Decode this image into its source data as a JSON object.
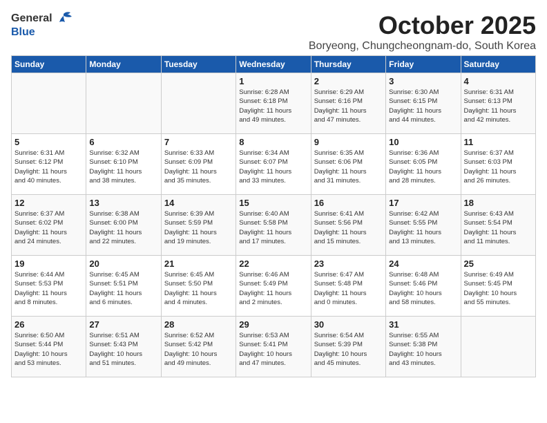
{
  "header": {
    "logo_general": "General",
    "logo_blue": "Blue",
    "main_title": "October 2025",
    "subtitle": "Boryeong, Chungcheongnam-do, South Korea"
  },
  "days_of_week": [
    "Sunday",
    "Monday",
    "Tuesday",
    "Wednesday",
    "Thursday",
    "Friday",
    "Saturday"
  ],
  "weeks": [
    [
      {
        "num": "",
        "info": ""
      },
      {
        "num": "",
        "info": ""
      },
      {
        "num": "",
        "info": ""
      },
      {
        "num": "1",
        "info": "Sunrise: 6:28 AM\nSunset: 6:18 PM\nDaylight: 11 hours\nand 49 minutes."
      },
      {
        "num": "2",
        "info": "Sunrise: 6:29 AM\nSunset: 6:16 PM\nDaylight: 11 hours\nand 47 minutes."
      },
      {
        "num": "3",
        "info": "Sunrise: 6:30 AM\nSunset: 6:15 PM\nDaylight: 11 hours\nand 44 minutes."
      },
      {
        "num": "4",
        "info": "Sunrise: 6:31 AM\nSunset: 6:13 PM\nDaylight: 11 hours\nand 42 minutes."
      }
    ],
    [
      {
        "num": "5",
        "info": "Sunrise: 6:31 AM\nSunset: 6:12 PM\nDaylight: 11 hours\nand 40 minutes."
      },
      {
        "num": "6",
        "info": "Sunrise: 6:32 AM\nSunset: 6:10 PM\nDaylight: 11 hours\nand 38 minutes."
      },
      {
        "num": "7",
        "info": "Sunrise: 6:33 AM\nSunset: 6:09 PM\nDaylight: 11 hours\nand 35 minutes."
      },
      {
        "num": "8",
        "info": "Sunrise: 6:34 AM\nSunset: 6:07 PM\nDaylight: 11 hours\nand 33 minutes."
      },
      {
        "num": "9",
        "info": "Sunrise: 6:35 AM\nSunset: 6:06 PM\nDaylight: 11 hours\nand 31 minutes."
      },
      {
        "num": "10",
        "info": "Sunrise: 6:36 AM\nSunset: 6:05 PM\nDaylight: 11 hours\nand 28 minutes."
      },
      {
        "num": "11",
        "info": "Sunrise: 6:37 AM\nSunset: 6:03 PM\nDaylight: 11 hours\nand 26 minutes."
      }
    ],
    [
      {
        "num": "12",
        "info": "Sunrise: 6:37 AM\nSunset: 6:02 PM\nDaylight: 11 hours\nand 24 minutes."
      },
      {
        "num": "13",
        "info": "Sunrise: 6:38 AM\nSunset: 6:00 PM\nDaylight: 11 hours\nand 22 minutes."
      },
      {
        "num": "14",
        "info": "Sunrise: 6:39 AM\nSunset: 5:59 PM\nDaylight: 11 hours\nand 19 minutes."
      },
      {
        "num": "15",
        "info": "Sunrise: 6:40 AM\nSunset: 5:58 PM\nDaylight: 11 hours\nand 17 minutes."
      },
      {
        "num": "16",
        "info": "Sunrise: 6:41 AM\nSunset: 5:56 PM\nDaylight: 11 hours\nand 15 minutes."
      },
      {
        "num": "17",
        "info": "Sunrise: 6:42 AM\nSunset: 5:55 PM\nDaylight: 11 hours\nand 13 minutes."
      },
      {
        "num": "18",
        "info": "Sunrise: 6:43 AM\nSunset: 5:54 PM\nDaylight: 11 hours\nand 11 minutes."
      }
    ],
    [
      {
        "num": "19",
        "info": "Sunrise: 6:44 AM\nSunset: 5:53 PM\nDaylight: 11 hours\nand 8 minutes."
      },
      {
        "num": "20",
        "info": "Sunrise: 6:45 AM\nSunset: 5:51 PM\nDaylight: 11 hours\nand 6 minutes."
      },
      {
        "num": "21",
        "info": "Sunrise: 6:45 AM\nSunset: 5:50 PM\nDaylight: 11 hours\nand 4 minutes."
      },
      {
        "num": "22",
        "info": "Sunrise: 6:46 AM\nSunset: 5:49 PM\nDaylight: 11 hours\nand 2 minutes."
      },
      {
        "num": "23",
        "info": "Sunrise: 6:47 AM\nSunset: 5:48 PM\nDaylight: 11 hours\nand 0 minutes."
      },
      {
        "num": "24",
        "info": "Sunrise: 6:48 AM\nSunset: 5:46 PM\nDaylight: 10 hours\nand 58 minutes."
      },
      {
        "num": "25",
        "info": "Sunrise: 6:49 AM\nSunset: 5:45 PM\nDaylight: 10 hours\nand 55 minutes."
      }
    ],
    [
      {
        "num": "26",
        "info": "Sunrise: 6:50 AM\nSunset: 5:44 PM\nDaylight: 10 hours\nand 53 minutes."
      },
      {
        "num": "27",
        "info": "Sunrise: 6:51 AM\nSunset: 5:43 PM\nDaylight: 10 hours\nand 51 minutes."
      },
      {
        "num": "28",
        "info": "Sunrise: 6:52 AM\nSunset: 5:42 PM\nDaylight: 10 hours\nand 49 minutes."
      },
      {
        "num": "29",
        "info": "Sunrise: 6:53 AM\nSunset: 5:41 PM\nDaylight: 10 hours\nand 47 minutes."
      },
      {
        "num": "30",
        "info": "Sunrise: 6:54 AM\nSunset: 5:39 PM\nDaylight: 10 hours\nand 45 minutes."
      },
      {
        "num": "31",
        "info": "Sunrise: 6:55 AM\nSunset: 5:38 PM\nDaylight: 10 hours\nand 43 minutes."
      },
      {
        "num": "",
        "info": ""
      }
    ]
  ]
}
